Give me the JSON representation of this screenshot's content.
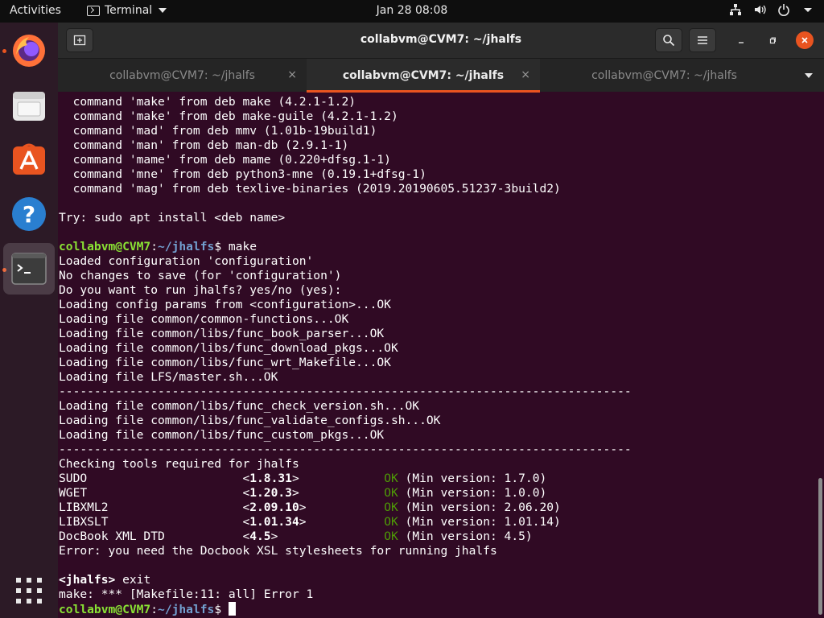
{
  "topbar": {
    "activities": "Activities",
    "app_name": "Terminal",
    "clock": "Jan 28  08:08"
  },
  "dock": {
    "items": [
      {
        "name": "firefox-icon"
      },
      {
        "name": "files-icon"
      },
      {
        "name": "software-icon"
      },
      {
        "name": "help-icon"
      },
      {
        "name": "terminal-icon"
      },
      {
        "name": "app-grid-icon"
      }
    ]
  },
  "window": {
    "title": "collabvm@CVM7: ~/jhalfs",
    "tabs": [
      {
        "label": "collabvm@CVM7: ~/jhalfs",
        "active": false
      },
      {
        "label": "collabvm@CVM7: ~/jhalfs",
        "active": true
      },
      {
        "label": "collabvm@CVM7: ~/jhalfs",
        "active": false
      }
    ],
    "close_glyph": "×"
  },
  "terminal": {
    "lines": [
      [
        {
          "t": "  command 'make' from deb make (4.2.1-1.2)"
        }
      ],
      [
        {
          "t": "  command 'make' from deb make-guile (4.2.1-1.2)"
        }
      ],
      [
        {
          "t": "  command 'mad' from deb mmv (1.01b-19build1)"
        }
      ],
      [
        {
          "t": "  command 'man' from deb man-db (2.9.1-1)"
        }
      ],
      [
        {
          "t": "  command 'mame' from deb mame (0.220+dfsg.1-1)"
        }
      ],
      [
        {
          "t": "  command 'mne' from deb python3-mne (0.19.1+dfsg-1)"
        }
      ],
      [
        {
          "t": "  command 'mag' from deb texlive-binaries (2019.20190605.51237-3build2)"
        }
      ],
      [
        {
          "t": ""
        }
      ],
      [
        {
          "t": "Try: sudo apt install <deb name>"
        }
      ],
      [
        {
          "t": ""
        }
      ],
      [
        {
          "t": "collabvm@CVM7",
          "c": "user"
        },
        {
          "t": ":"
        },
        {
          "t": "~/jhalfs",
          "c": "path"
        },
        {
          "t": "$ make"
        }
      ],
      [
        {
          "t": "Loaded configuration 'configuration'"
        }
      ],
      [
        {
          "t": "No changes to save (for 'configuration')"
        }
      ],
      [
        {
          "t": "Do you want to run jhalfs? yes/no (yes):"
        }
      ],
      [
        {
          "t": "Loading config params from <configuration>...OK"
        }
      ],
      [
        {
          "t": "Loading file common/common-functions...OK"
        }
      ],
      [
        {
          "t": "Loading file common/libs/func_book_parser...OK"
        }
      ],
      [
        {
          "t": "Loading file common/libs/func_download_pkgs...OK"
        }
      ],
      [
        {
          "t": "Loading file common/libs/func_wrt_Makefile...OK"
        }
      ],
      [
        {
          "t": "Loading file LFS/master.sh...OK"
        }
      ],
      [
        {
          "t": "---------------------------------------------------------------------------------"
        }
      ],
      [
        {
          "t": "Loading file common/libs/func_check_version.sh...OK"
        }
      ],
      [
        {
          "t": "Loading file common/libs/func_validate_configs.sh...OK"
        }
      ],
      [
        {
          "t": "Loading file common/libs/func_custom_pkgs...OK"
        }
      ],
      [
        {
          "t": "---------------------------------------------------------------------------------"
        }
      ],
      [
        {
          "t": "Checking tools required for jhalfs"
        }
      ],
      [
        {
          "t": "SUDO                      <"
        },
        {
          "t": "1.8.31",
          "c": "bold"
        },
        {
          "t": ">            "
        },
        {
          "t": "OK",
          "c": "ok"
        },
        {
          "t": " (Min version: 1.7.0)"
        }
      ],
      [
        {
          "t": "WGET                      <"
        },
        {
          "t": "1.20.3",
          "c": "bold"
        },
        {
          "t": ">            "
        },
        {
          "t": "OK",
          "c": "ok"
        },
        {
          "t": " (Min version: 1.0.0)"
        }
      ],
      [
        {
          "t": "LIBXML2                   <"
        },
        {
          "t": "2.09.10",
          "c": "bold"
        },
        {
          "t": ">           "
        },
        {
          "t": "OK",
          "c": "ok"
        },
        {
          "t": " (Min version: 2.06.20)"
        }
      ],
      [
        {
          "t": "LIBXSLT                   <"
        },
        {
          "t": "1.01.34",
          "c": "bold"
        },
        {
          "t": ">           "
        },
        {
          "t": "OK",
          "c": "ok"
        },
        {
          "t": " (Min version: 1.01.14)"
        }
      ],
      [
        {
          "t": "DocBook XML DTD           <"
        },
        {
          "t": "4.5",
          "c": "bold"
        },
        {
          "t": ">               "
        },
        {
          "t": "OK",
          "c": "ok"
        },
        {
          "t": " (Min version: 4.5)"
        }
      ],
      [
        {
          "t": "Error: you need the Docbook XSL stylesheets for running jhalfs"
        }
      ],
      [
        {
          "t": ""
        }
      ],
      [
        {
          "t": "<jhalfs>",
          "c": "bold"
        },
        {
          "t": " exit"
        }
      ],
      [
        {
          "t": "make: *** [Makefile:11: all] Error 1"
        }
      ],
      [
        {
          "t": "collabvm@CVM7",
          "c": "user"
        },
        {
          "t": ":"
        },
        {
          "t": "~/jhalfs",
          "c": "path"
        },
        {
          "t": "$ "
        },
        {
          "cursor": true
        }
      ]
    ]
  },
  "colors": {
    "accent": "#e95420",
    "terminal_bg": "#300a24",
    "prompt_user": "#8ae234",
    "prompt_path": "#729fcf",
    "ok_green": "#4e9a06"
  }
}
